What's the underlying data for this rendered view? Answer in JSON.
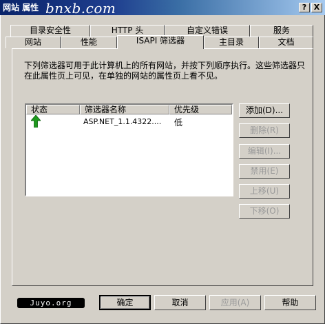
{
  "window": {
    "title": "网站 属性",
    "watermark": "bnxb.com",
    "help_glyph": "?",
    "close_glyph": "X"
  },
  "tabs": {
    "row1": [
      "目录安全性",
      "HTTP 头",
      "自定义错误",
      "服务"
    ],
    "row2": [
      "网站",
      "性能",
      "ISAPI 筛选器",
      "主目录",
      "文档"
    ],
    "active": "ISAPI 筛选器"
  },
  "description": "下列筛选器可用于此计算机上的所有网站，并按下列顺序执行。这些筛选器只在此属性页上可见，在单独的网站的属性页上看不见。",
  "filter_list": {
    "columns": [
      "状态",
      "筛选器名称",
      "优先级"
    ],
    "rows": [
      {
        "status_icon": "green-up-arrow-icon",
        "name": "ASP.NET_1.1.4322....",
        "priority": "低"
      }
    ]
  },
  "side_buttons": {
    "add": "添加(D)...",
    "remove": "删除(R)",
    "edit": "编辑(I)...",
    "disable": "禁用(E)",
    "move_up": "上移(U)",
    "move_down": "下移(O)"
  },
  "badge": "Juyo.org",
  "bottom_buttons": {
    "ok": "确定",
    "cancel": "取消",
    "apply": "应用(A)",
    "help": "帮助"
  },
  "colors": {
    "titlebar_start": "#0a246a",
    "titlebar_end": "#a6caf0",
    "face": "#d4d0c8",
    "status_arrow": "#1e9a1e"
  }
}
